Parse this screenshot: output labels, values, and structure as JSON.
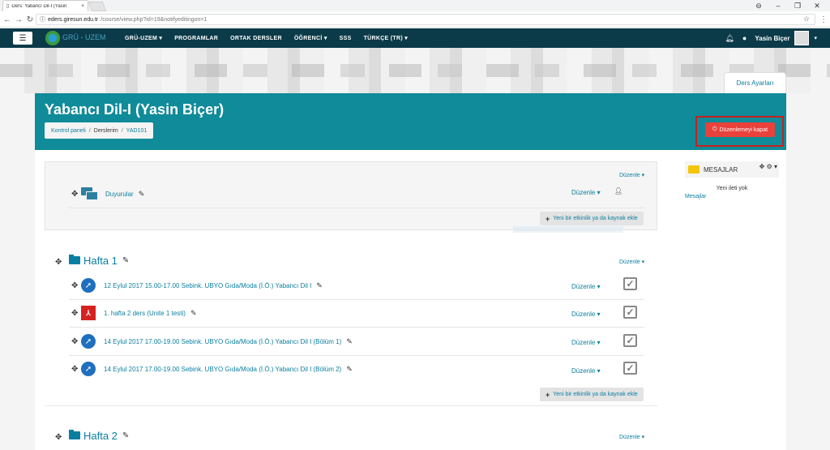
{
  "browser": {
    "tab_title": "Ders: Yabancı Dil-I (Yasin",
    "tab_close": "×",
    "url_host": "eders.giresun.edu.tr",
    "url_path": "/course/view.php?id=19&notifyeditingon=1",
    "star": "☆",
    "controls": {
      "account": "⊖",
      "min": "–",
      "restore": "❐",
      "close": "✕"
    }
  },
  "navbar": {
    "logo_text": "GRÜ - UZEM",
    "items": [
      "GRÜ-UZEM ▾",
      "PROGRAMLAR",
      "ORTAK DERSLER",
      "ÖĞRENCİ ▾",
      "SSS",
      "TÜRKÇE (TR) ▾"
    ],
    "username": "Yasin Biçer"
  },
  "settings_tab": "Ders Ayarları",
  "header": {
    "course_title": "Yabancı Dil-I (Yasin Biçer)",
    "breadcrumbs": [
      "Kontrol paneli",
      "Derslerim",
      "YAD101"
    ],
    "edit_off_button": "Düzenlemeyi kapat"
  },
  "section0": {
    "edit_label": "Düzenle ▾",
    "activity": {
      "name": "Duyurular",
      "edit": "Düzenle ▾"
    },
    "add_button": "Yeni bir etkinlik ya da kaynak ekle"
  },
  "sections": [
    {
      "title": "Hafta 1",
      "edit_label": "Düzenle ▾",
      "activities": [
        {
          "name": "12 Eylul 2017 15.00-17.00 Sebink. UBYO Gıda/Moda (İ.Ö.) Yabancı Dil I",
          "edit": "Düzenle ▾"
        },
        {
          "name": "1. hafta 2 ders (Unite 1 testi)",
          "edit": "Düzenle ▾"
        },
        {
          "name": "14 Eylul 2017 17.00-19.00 Sebink. UBYO Gıda/Moda (İ.Ö.) Yabancı Dil I (Bölüm 1)",
          "edit": "Düzenle ▾"
        },
        {
          "name": "14 Eylul 2017 17.00-19.00 Sebink. UBYO Gıda/Moda (İ.Ö.) Yabancı Dil I (Bölüm 2)",
          "edit": "Düzenle ▾"
        }
      ],
      "add_button": "Yeni bir etkinlik ya da kaynak ekle"
    },
    {
      "title": "Hafta 2",
      "edit_label": "Düzenle ▾"
    }
  ],
  "messages_block": {
    "title": "MESAJLAR",
    "empty_text": "Yeni ileti yok",
    "link": "Mesajlar"
  }
}
